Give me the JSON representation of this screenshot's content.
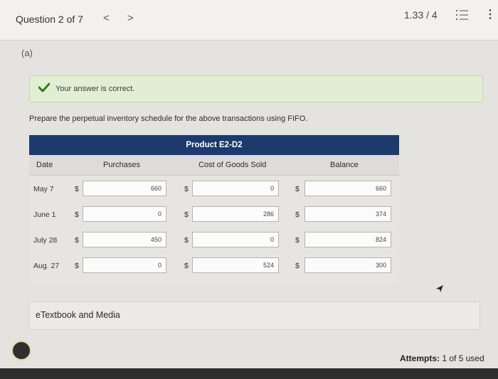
{
  "header": {
    "question_label": "Question 2 of 7",
    "prev_glyph": "<",
    "next_glyph": ">",
    "score": "1.33 / 4",
    "more_glyph": "⋮"
  },
  "part_label": "(a)",
  "feedback": {
    "message": "Your answer is correct."
  },
  "prompt": "Prepare the perpetual inventory schedule for the above transactions using FIFO.",
  "table": {
    "product": "Product E2-D2",
    "columns": {
      "date": "Date",
      "purchases": "Purchases",
      "cogs": "Cost of Goods Sold",
      "balance": "Balance"
    },
    "currency": "$",
    "rows": [
      {
        "date": "May 7",
        "purchases": "660",
        "cogs": "0",
        "balance": "660"
      },
      {
        "date": "June 1",
        "purchases": "0",
        "cogs": "286",
        "balance": "374"
      },
      {
        "date": "July 28",
        "purchases": "450",
        "cogs": "0",
        "balance": "824"
      },
      {
        "date": "Aug. 27",
        "purchases": "0",
        "cogs": "524",
        "balance": "300"
      }
    ]
  },
  "resources": {
    "etextbook_label": "eTextbook and Media"
  },
  "attempts": {
    "label": "Attempts:",
    "value": "1 of 5 used"
  },
  "colors": {
    "header_navy": "#1d3a6d",
    "correct_bg": "#e2eed4",
    "check_green": "#2e7d1f"
  }
}
